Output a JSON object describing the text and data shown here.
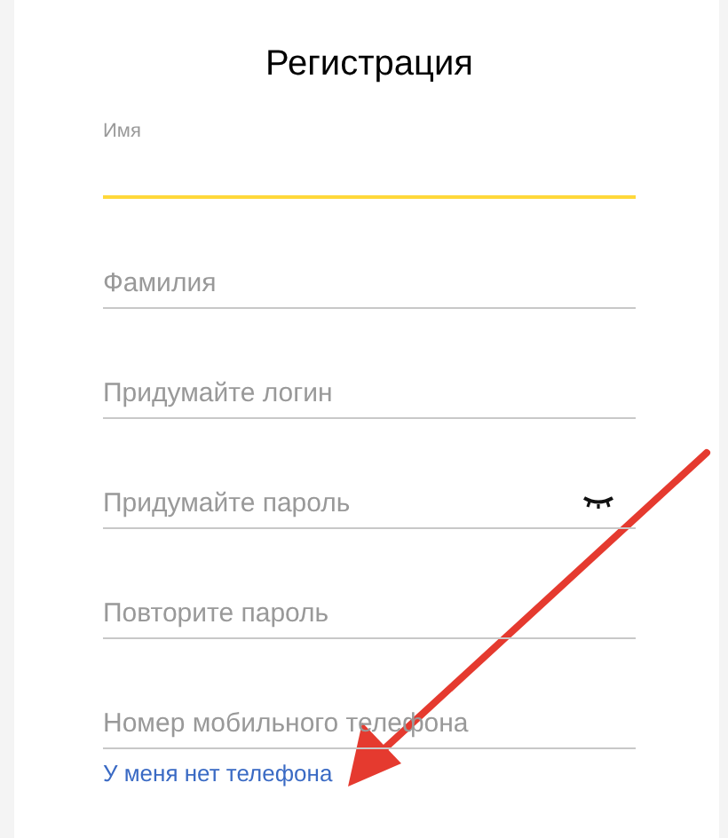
{
  "title": "Регистрация",
  "fields": [
    {
      "placeholder": "Имя",
      "kind": "text",
      "focused": true
    },
    {
      "placeholder": "Фамилия",
      "kind": "text",
      "focused": false
    },
    {
      "placeholder": "Придумайте логин",
      "kind": "text",
      "focused": false
    },
    {
      "placeholder": "Придумайте пароль",
      "kind": "password",
      "focused": false
    },
    {
      "placeholder": "Повторите пароль",
      "kind": "text",
      "focused": false
    },
    {
      "placeholder": "Номер мобильного телефона",
      "kind": "text",
      "focused": false
    }
  ],
  "no_phone_link": "У меня нет телефона"
}
